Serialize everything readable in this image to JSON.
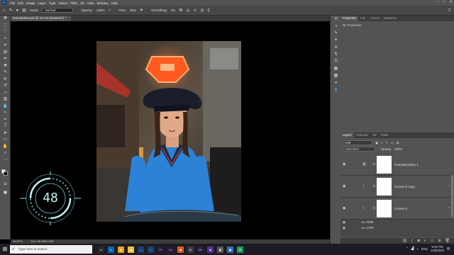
{
  "menubar": {
    "logo": "Ps",
    "items": [
      "File",
      "Edit",
      "Image",
      "Layer",
      "Type",
      "Select",
      "Filter",
      "3D",
      "View",
      "Window",
      "Help"
    ],
    "window_controls": [
      "–",
      "□",
      "✕"
    ]
  },
  "options": {
    "mode_label": "Mode:",
    "mode_value": "Normal",
    "opacity_label": "Opacity:",
    "opacity_value": "100%",
    "flow_label": "Flow:",
    "flow_value": "25%",
    "smoothing_label": "Smoothing:",
    "smoothing_value": "0%",
    "angle_value": "0°"
  },
  "document": {
    "tab_title": "DSC00282.psd @ 16.7% (RGB/16*) *",
    "zoom": "16.67%",
    "doc_size": "Doc: 96.9M/1.58G"
  },
  "hud": {
    "value": "48"
  },
  "properties": {
    "tabs": [
      "Properties",
      "Info",
      "Actions",
      "Swatches"
    ],
    "empty_text": "No Properties"
  },
  "layers": {
    "tabs": [
      "Layers",
      "Channels",
      "3D",
      "Paths"
    ],
    "kind_label": "Kind",
    "blend_mode": "Color Burn",
    "opacity_label": "Opacity:",
    "opacity_value": "100%",
    "lock_label": "Lock:",
    "fill_label": "Fill:",
    "fill_value": "0%",
    "items": [
      {
        "name": "Hue/Saturation 1",
        "type": "hue"
      },
      {
        "name": "Curves 6 copy",
        "type": "curves"
      },
      {
        "name": "Curves 6",
        "type": "curves"
      }
    ],
    "groups": [
      "GDB",
      "COR"
    ]
  },
  "taskbar": {
    "search_placeholder": "Type here to search",
    "language": "ENG",
    "time": "5:02 PM",
    "date": "11/6/2020"
  },
  "colors": {
    "accent": "#31a8ff",
    "hud": "#8fe3e0"
  }
}
